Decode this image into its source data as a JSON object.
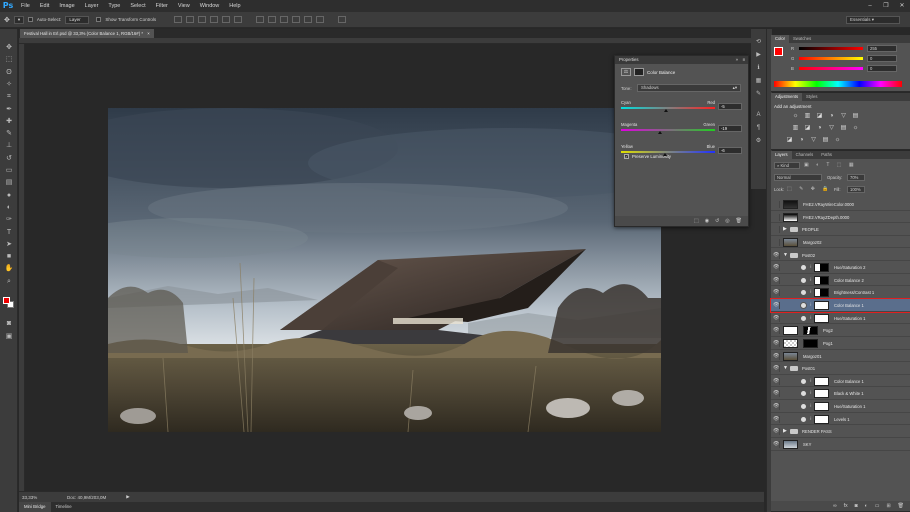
{
  "app": {
    "logo": "Ps"
  },
  "menu": [
    "File",
    "Edit",
    "Image",
    "Layer",
    "Type",
    "Select",
    "Filter",
    "View",
    "Window",
    "Help"
  ],
  "window_controls": [
    "–",
    "❐",
    "✕"
  ],
  "options_bar": {
    "auto_select_label": "Auto-Select:",
    "auto_select_value": "Layer",
    "show_transform_label": "Show Transform Controls",
    "workspace": "Essentials"
  },
  "document": {
    "tab_title": "Festival Hall in Erl.psd @ 33,3% (Color Balance 1, RGB/16#) *",
    "close": "×"
  },
  "status": {
    "zoom": "33,33%",
    "doc": "Doc: 40,9M/203,0M"
  },
  "bottom_tabs": [
    "Mini Bridge",
    "Timeline"
  ],
  "properties": {
    "title": "Properties",
    "panel_name": "Color Balance",
    "tone_label": "Tone:",
    "tone_value": "Shadows",
    "sliders": [
      {
        "left": "Cyan",
        "right": "Red",
        "value": "-5",
        "position": 0.48,
        "gradient": [
          "#00e0e0",
          "#ff2020"
        ]
      },
      {
        "left": "Magenta",
        "right": "Green",
        "value": "-19",
        "position": 0.41,
        "gradient": [
          "#e000e0",
          "#20d020"
        ]
      },
      {
        "left": "Yellow",
        "right": "Blue",
        "value": "-6",
        "position": 0.47,
        "gradient": [
          "#e0e000",
          "#2030ff"
        ]
      }
    ],
    "preserve_label": "Preserve Luminosity"
  },
  "color_panel": {
    "tabs": [
      "Color",
      "Swatches"
    ],
    "channels": [
      {
        "label": "R",
        "value": "255"
      },
      {
        "label": "G",
        "value": "0"
      },
      {
        "label": "B",
        "value": "0"
      }
    ]
  },
  "adjustments": {
    "tabs": [
      "Adjustments",
      "Styles"
    ],
    "title": "Add an adjustment"
  },
  "layers_panel": {
    "tabs": [
      "Layers",
      "Channels",
      "Paths"
    ],
    "kind": "Kind",
    "blend_mode": "Normal",
    "opacity_label": "Opacity:",
    "opacity_value": "70%",
    "lock_label": "Lock:",
    "fill_label": "Fill:",
    "fill_value": "100%"
  },
  "layers": [
    {
      "name": "FHE2.VRayWireColor.0000",
      "indent": 0,
      "visible": false,
      "type": "image",
      "thumb": "dark"
    },
    {
      "name": "FHE2.VRayZDepth.0000",
      "indent": 0,
      "visible": false,
      "type": "image",
      "thumb": "depth"
    },
    {
      "name": "PEOPLE",
      "indent": 0,
      "visible": false,
      "type": "group",
      "open": false
    },
    {
      "name": "Margoz02",
      "indent": 0,
      "visible": false,
      "type": "image",
      "thumb": "photo"
    },
    {
      "name": "Post02",
      "indent": 0,
      "visible": true,
      "type": "group",
      "open": true
    },
    {
      "name": "Hue/Saturation 2",
      "indent": 1,
      "visible": true,
      "type": "adj",
      "mask": "blackpart"
    },
    {
      "name": "Color Balance 2",
      "indent": 1,
      "visible": true,
      "type": "adj",
      "mask": "blackpart"
    },
    {
      "name": "Brightness/Contrast 1",
      "indent": 1,
      "visible": true,
      "type": "adj",
      "mask": "blackpart"
    },
    {
      "name": "Color Balance 1",
      "indent": 1,
      "visible": true,
      "type": "adj",
      "mask": "white",
      "selected": true
    },
    {
      "name": "Hue/Saturation 1",
      "indent": 1,
      "visible": true,
      "type": "adj",
      "mask": "white"
    },
    {
      "name": "Pog2",
      "indent": 0,
      "visible": true,
      "type": "image",
      "thumb": "white",
      "mask": "blackfig"
    },
    {
      "name": "Pog1",
      "indent": 0,
      "visible": true,
      "type": "image",
      "thumb": "checker",
      "mask": "black"
    },
    {
      "name": "Margoz01",
      "indent": 0,
      "visible": true,
      "type": "image",
      "thumb": "photo"
    },
    {
      "name": "Post01",
      "indent": 0,
      "visible": true,
      "type": "group",
      "open": true
    },
    {
      "name": "Color Balance 1",
      "indent": 1,
      "visible": true,
      "type": "adj",
      "mask": "white"
    },
    {
      "name": "Black & White 1",
      "indent": 1,
      "visible": true,
      "type": "adj",
      "mask": "white"
    },
    {
      "name": "Hue/Saturation 1",
      "indent": 1,
      "visible": true,
      "type": "adj",
      "mask": "white"
    },
    {
      "name": "Levels 1",
      "indent": 1,
      "visible": true,
      "type": "adj",
      "mask": "white"
    },
    {
      "name": "RENDER PASS",
      "indent": 0,
      "visible": true,
      "type": "group",
      "open": false
    },
    {
      "name": "SKY",
      "indent": 0,
      "visible": true,
      "type": "image",
      "thumb": "sky"
    }
  ],
  "colors": {
    "accent": "#ff0000",
    "selection": "#5a6e8c",
    "panel": "#535353"
  }
}
